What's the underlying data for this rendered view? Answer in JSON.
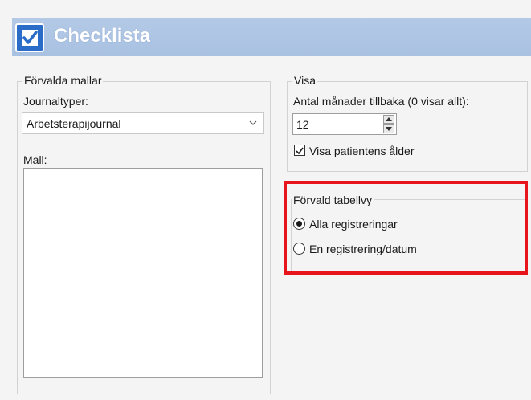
{
  "header": {
    "title": "Checklista",
    "icon": "checkbox-checked-icon"
  },
  "templates": {
    "legend": "Förvalda mallar",
    "journal_types_label": "Journaltyper:",
    "journal_types_value": "Arbetsterapijournal",
    "template_label": "Mall:"
  },
  "display": {
    "legend": "Visa",
    "months_label": "Antal månader tillbaka (0 visar allt):",
    "months_value": "12",
    "show_age_label": "Visa patientens ålder",
    "show_age_checked": true
  },
  "default_table_view": {
    "legend": "Förvald tabellvy",
    "options": [
      {
        "label": "Alla registreringar",
        "selected": true
      },
      {
        "label": "En registrering/datum",
        "selected": false
      }
    ]
  },
  "colors": {
    "header_bg": "#a9c1e2",
    "highlight": "#e8141b",
    "icon_bg": "#2a6cc7"
  }
}
